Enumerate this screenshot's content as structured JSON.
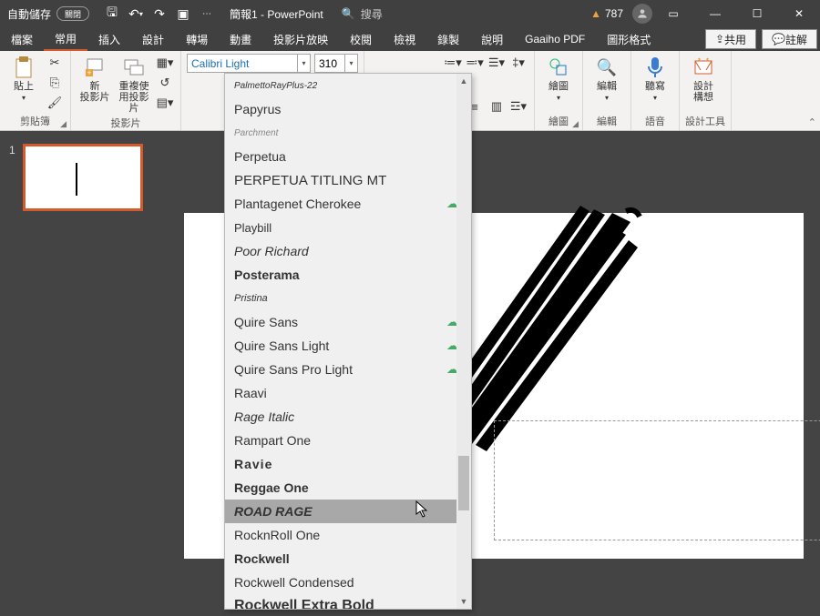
{
  "titlebar": {
    "autosave_label": "自動儲存",
    "toggle_state": "關閉",
    "doc_name": "簡報1 - PowerPoint",
    "search_placeholder": "搜尋",
    "warning_count": "787"
  },
  "tabs": {
    "items": [
      {
        "label": "檔案"
      },
      {
        "label": "常用"
      },
      {
        "label": "插入"
      },
      {
        "label": "設計"
      },
      {
        "label": "轉場"
      },
      {
        "label": "動畫"
      },
      {
        "label": "投影片放映"
      },
      {
        "label": "校閱"
      },
      {
        "label": "檢視"
      },
      {
        "label": "錄製"
      },
      {
        "label": "說明"
      },
      {
        "label": "Gaaiho PDF"
      },
      {
        "label": "圖形格式"
      }
    ],
    "active_index": 1,
    "share": "共用",
    "comment": "註解"
  },
  "ribbon": {
    "clipboard": {
      "label": "剪貼簿",
      "paste": "貼上"
    },
    "slides": {
      "label": "投影片",
      "new": "新\n投影片",
      "reuse": "重複使\n用投影片"
    },
    "font": {
      "name": "Calibri Light",
      "size": "310"
    },
    "drawing": {
      "label": "繪圖",
      "btn": "繪圖"
    },
    "editing": {
      "label": "編輯",
      "btn": "編輯"
    },
    "voice": {
      "label": "語音",
      "btn": "聽寫"
    },
    "designer": {
      "label": "設計工具",
      "btn": "設計\n構想"
    }
  },
  "thumbs": {
    "current": "1"
  },
  "font_dropdown": {
    "items": [
      {
        "label": "PalmettoRayPlus-22",
        "style": "font-size:10px;font-style:italic;"
      },
      {
        "label": "Papyrus",
        "style": "font-family:Papyrus,fantasy;"
      },
      {
        "label": "Parchment",
        "style": "font-size:10px;font-style:italic;color:#888;"
      },
      {
        "label": "Perpetua",
        "style": "font-family:Georgia,serif;"
      },
      {
        "label": "PERPETUA TITLING MT",
        "style": "font-family:Georgia,serif;font-size:15px;"
      },
      {
        "label": "Plantagenet Cherokee",
        "style": "font-family:Georgia,serif;",
        "cloud": true
      },
      {
        "label": "Playbill",
        "style": "font-family:Impact,sans-serif;font-size:13px;"
      },
      {
        "label": "Poor Richard",
        "style": "font-family:Georgia,serif;font-style:italic;"
      },
      {
        "label": "Posterama",
        "style": "font-weight:600;"
      },
      {
        "label": "Pristina",
        "style": "font-style:italic;font-size:11px;"
      },
      {
        "label": "Quire Sans",
        "style": "",
        "cloud": true
      },
      {
        "label": "Quire Sans Light",
        "style": "font-weight:300;",
        "cloud": true
      },
      {
        "label": "Quire Sans Pro Light",
        "style": "font-weight:300;",
        "cloud": true
      },
      {
        "label": "Raavi",
        "style": ""
      },
      {
        "label": "Rage Italic",
        "style": "font-style:italic;font-family:cursive;"
      },
      {
        "label": "Rampart One",
        "style": "font-family:serif;"
      },
      {
        "label": "Ravie",
        "style": "font-family:Impact,fantasy;font-weight:900;letter-spacing:1px;"
      },
      {
        "label": "Reggae One",
        "style": "font-weight:600;"
      },
      {
        "label": "ROAD RAGE",
        "style": "font-style:italic;font-weight:700;",
        "hover": true
      },
      {
        "label": "RocknRoll One",
        "style": ""
      },
      {
        "label": "Rockwell",
        "style": "font-family:Rockwell,serif;font-weight:600;"
      },
      {
        "label": "Rockwell Condensed",
        "style": "font-family:Rockwell,serif;font-stretch:condensed;"
      },
      {
        "label": "Rockwell Extra Bold",
        "style": "font-family:Rockwell,serif;font-weight:900;font-size:16px;"
      }
    ]
  }
}
